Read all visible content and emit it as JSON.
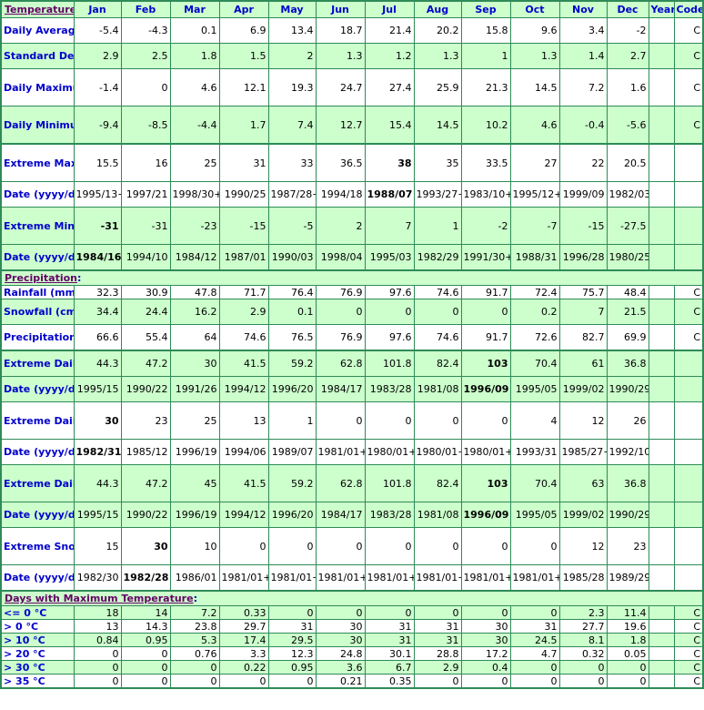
{
  "header": {
    "section_title": "Temperature",
    "columns": [
      "Jan",
      "Feb",
      "Mar",
      "Apr",
      "May",
      "Jun",
      "Jul",
      "Aug",
      "Sep",
      "Oct",
      "Nov",
      "Dec",
      "Year",
      "Code"
    ]
  },
  "temperature": {
    "rows": [
      {
        "label": "Daily Average (°C)",
        "values": [
          "-5.4",
          "-4.3",
          "0.1",
          "6.9",
          "13.4",
          "18.7",
          "21.4",
          "20.2",
          "15.8",
          "9.6",
          "3.4",
          "-2"
        ],
        "year": "",
        "code": "C",
        "bold_index": -1
      },
      {
        "label": "Standard Deviation",
        "values": [
          "2.9",
          "2.5",
          "1.8",
          "1.5",
          "2",
          "1.3",
          "1.2",
          "1.3",
          "1",
          "1.3",
          "1.4",
          "2.7"
        ],
        "year": "",
        "code": "C",
        "bold_index": -1
      },
      {
        "label": "Daily Maximum (°C)",
        "values": [
          "-1.4",
          "0",
          "4.6",
          "12.1",
          "19.3",
          "24.7",
          "27.4",
          "25.9",
          "21.3",
          "14.5",
          "7.2",
          "1.6"
        ],
        "year": "",
        "code": "C",
        "bold_index": -1
      },
      {
        "label": "Daily Minimum (°C)",
        "values": [
          "-9.4",
          "-8.5",
          "-4.4",
          "1.7",
          "7.4",
          "12.7",
          "15.4",
          "14.5",
          "10.2",
          "4.6",
          "-0.4",
          "-5.6"
        ],
        "year": "",
        "code": "C",
        "bold_index": -1
      },
      {
        "label": "Extreme Maximum (°C)",
        "values": [
          "15.5",
          "16",
          "25",
          "31",
          "33",
          "36.5",
          "38",
          "35",
          "33.5",
          "27",
          "22",
          "20.5"
        ],
        "year": "",
        "code": "",
        "bold_index": 6
      },
      {
        "label": "Date (yyyy/dd)",
        "values": [
          "1995/13+",
          "1997/21",
          "1998/30+",
          "1990/25",
          "1987/28+",
          "1994/18",
          "1988/07",
          "1993/27+",
          "1983/10+",
          "1995/12+",
          "1999/09",
          "1982/03"
        ],
        "year": "",
        "code": "",
        "bold_index": 6
      },
      {
        "label": "Extreme Minimum (°C)",
        "values": [
          "-31",
          "-31",
          "-23",
          "-15",
          "-5",
          "2",
          "7",
          "1",
          "-2",
          "-7",
          "-15",
          "-27.5"
        ],
        "year": "",
        "code": "",
        "bold_index": 0
      },
      {
        "label": "Date (yyyy/dd)",
        "values": [
          "1984/16",
          "1994/10",
          "1984/12",
          "1987/01",
          "1990/03",
          "1998/04",
          "1995/03",
          "1982/29",
          "1991/30+",
          "1988/31",
          "1996/28",
          "1980/25"
        ],
        "year": "",
        "code": "",
        "bold_index": 0
      }
    ]
  },
  "precipitation": {
    "section_title": "Precipitation",
    "rows": [
      {
        "label": "Rainfall (mm)",
        "values": [
          "32.3",
          "30.9",
          "47.8",
          "71.7",
          "76.4",
          "76.9",
          "97.6",
          "74.6",
          "91.7",
          "72.4",
          "75.7",
          "48.4"
        ],
        "year": "",
        "code": "C",
        "bold_index": -1
      },
      {
        "label": "Snowfall (cm)",
        "values": [
          "34.4",
          "24.4",
          "16.2",
          "2.9",
          "0.1",
          "0",
          "0",
          "0",
          "0",
          "0.2",
          "7",
          "21.5"
        ],
        "year": "",
        "code": "C",
        "bold_index": -1
      },
      {
        "label": "Precipitation (mm)",
        "values": [
          "66.6",
          "55.4",
          "64",
          "74.6",
          "76.5",
          "76.9",
          "97.6",
          "74.6",
          "91.7",
          "72.6",
          "82.7",
          "69.9"
        ],
        "year": "",
        "code": "C",
        "bold_index": -1
      },
      {
        "label": "Extreme Daily Rainfall (mm)",
        "values": [
          "44.3",
          "47.2",
          "30",
          "41.5",
          "59.2",
          "62.8",
          "101.8",
          "82.4",
          "103",
          "70.4",
          "61",
          "36.8"
        ],
        "year": "",
        "code": "",
        "bold_index": 8
      },
      {
        "label": "Date (yyyy/dd)",
        "values": [
          "1995/15",
          "1990/22",
          "1991/26",
          "1994/12",
          "1996/20",
          "1984/17",
          "1983/28",
          "1981/08",
          "1996/09",
          "1995/05",
          "1999/02",
          "1990/29"
        ],
        "year": "",
        "code": "",
        "bold_index": 8
      },
      {
        "label": "Extreme Daily Snowfall (cm)",
        "values": [
          "30",
          "23",
          "25",
          "13",
          "1",
          "0",
          "0",
          "0",
          "0",
          "4",
          "12",
          "26"
        ],
        "year": "",
        "code": "",
        "bold_index": 0
      },
      {
        "label": "Date (yyyy/dd)",
        "values": [
          "1982/31",
          "1985/12",
          "1996/19",
          "1994/06",
          "1989/07",
          "1981/01+",
          "1980/01+",
          "1980/01+",
          "1980/01+",
          "1993/31",
          "1985/27+",
          "1992/10"
        ],
        "year": "",
        "code": "",
        "bold_index": 0
      },
      {
        "label": "Extreme Daily Precipitation (mm)",
        "values": [
          "44.3",
          "47.2",
          "45",
          "41.5",
          "59.2",
          "62.8",
          "101.8",
          "82.4",
          "103",
          "70.4",
          "63",
          "36.8"
        ],
        "year": "",
        "code": "",
        "bold_index": 8
      },
      {
        "label": "Date (yyyy/dd)",
        "values": [
          "1995/15",
          "1990/22",
          "1996/19",
          "1994/12",
          "1996/20",
          "1984/17",
          "1983/28",
          "1981/08",
          "1996/09",
          "1995/05",
          "1999/02",
          "1990/29"
        ],
        "year": "",
        "code": "",
        "bold_index": 8
      },
      {
        "label": "Extreme Snow Depth (cm)",
        "values": [
          "15",
          "30",
          "10",
          "0",
          "0",
          "0",
          "0",
          "0",
          "0",
          "0",
          "12",
          "23"
        ],
        "year": "",
        "code": "",
        "bold_index": 1
      },
      {
        "label": "Date (yyyy/dd)",
        "values": [
          "1982/30",
          "1982/28",
          "1986/01",
          "1981/01+",
          "1981/01+",
          "1981/01+",
          "1981/01+",
          "1981/01+",
          "1981/01+",
          "1981/01+",
          "1985/28",
          "1989/29"
        ],
        "year": "",
        "code": "",
        "bold_index": 1
      }
    ]
  },
  "days_max_temp": {
    "section_title": "Days with Maximum Temperature",
    "rows": [
      {
        "label": "<= 0 °C",
        "values": [
          "18",
          "14",
          "7.2",
          "0.33",
          "0",
          "0",
          "0",
          "0",
          "0",
          "0",
          "2.3",
          "11.4"
        ],
        "year": "",
        "code": "C",
        "bold_index": -1
      },
      {
        "label": "> 0 °C",
        "values": [
          "13",
          "14.3",
          "23.8",
          "29.7",
          "31",
          "30",
          "31",
          "31",
          "30",
          "31",
          "27.7",
          "19.6"
        ],
        "year": "",
        "code": "C",
        "bold_index": -1
      },
      {
        "label": "> 10 °C",
        "values": [
          "0.84",
          "0.95",
          "5.3",
          "17.4",
          "29.5",
          "30",
          "31",
          "31",
          "30",
          "24.5",
          "8.1",
          "1.8"
        ],
        "year": "",
        "code": "C",
        "bold_index": -1
      },
      {
        "label": "> 20 °C",
        "values": [
          "0",
          "0",
          "0.76",
          "3.3",
          "12.3",
          "24.8",
          "30.1",
          "28.8",
          "17.2",
          "4.7",
          "0.32",
          "0.05"
        ],
        "year": "",
        "code": "C",
        "bold_index": -1
      },
      {
        "label": "> 30 °C",
        "values": [
          "0",
          "0",
          "0",
          "0.22",
          "0.95",
          "3.6",
          "6.7",
          "2.9",
          "0.4",
          "0",
          "0",
          "0"
        ],
        "year": "",
        "code": "C",
        "bold_index": -1
      },
      {
        "label": "> 35 °C",
        "values": [
          "0",
          "0",
          "0",
          "0",
          "0",
          "0.21",
          "0.35",
          "0",
          "0",
          "0",
          "0",
          "0"
        ],
        "year": "",
        "code": "C",
        "bold_index": -1
      }
    ]
  },
  "colors": {
    "header_bg": "#ccffcc",
    "alt_row_bg": "#ccffcc",
    "border": "#2e8b57",
    "label_text": "#0000cc",
    "section_link": "#660066"
  }
}
